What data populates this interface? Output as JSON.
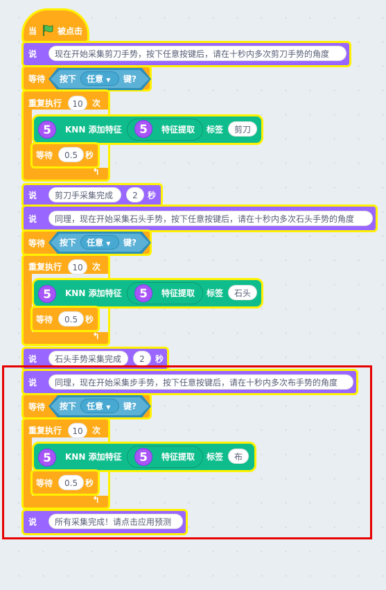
{
  "script": {
    "hat": {
      "when": "当",
      "flag_icon": "green-flag-icon",
      "clicked": "被点击"
    },
    "say_label": "说",
    "wait_label": "等待",
    "key_pressed": "按下",
    "key_option": "任意",
    "key_suffix": "键?",
    "repeat_label": "重复执行",
    "repeat_times_suffix": "次",
    "seconds_suffix": "秒",
    "knn_add": "KNN 添加特征",
    "feature_extract": "特征提取",
    "label_word": "标签",
    "ext_icon_text": "5",
    "say1": "现在开始采集剪刀手势，按下任意按键后，请在十秒内多次剪刀手势的角度",
    "repeat1_times": "10",
    "label1": "剪刀",
    "wait1_secs": "0.5",
    "say_secs1_text": "剪刀手采集完成",
    "say_secs1_secs": "2",
    "say2": "同理，现在开始采集石头手势，按下任意按键后，请在十秒内多次石头手势的角度",
    "repeat2_times": "10",
    "label2": "石头",
    "wait2_secs": "0.5",
    "say_secs2_text": "石头手势采集完成",
    "say_secs2_secs": "2",
    "say3": "同理，现在开始采集步手势，按下任意按键后，请在十秒内多次布手势的角度",
    "repeat3_times": "10",
    "label3": "布",
    "wait3_secs": "0.5",
    "say_final": "所有采集完成！请点击应用预测",
    "loop_arrow_icon": "loop-arrow-icon"
  },
  "colors": {
    "looks": "#9966ff",
    "control": "#ffab19",
    "sensing": "#5cb1d6",
    "extension": "#0fbd8c",
    "highlight": "#fff200",
    "selection": "#e60000"
  }
}
